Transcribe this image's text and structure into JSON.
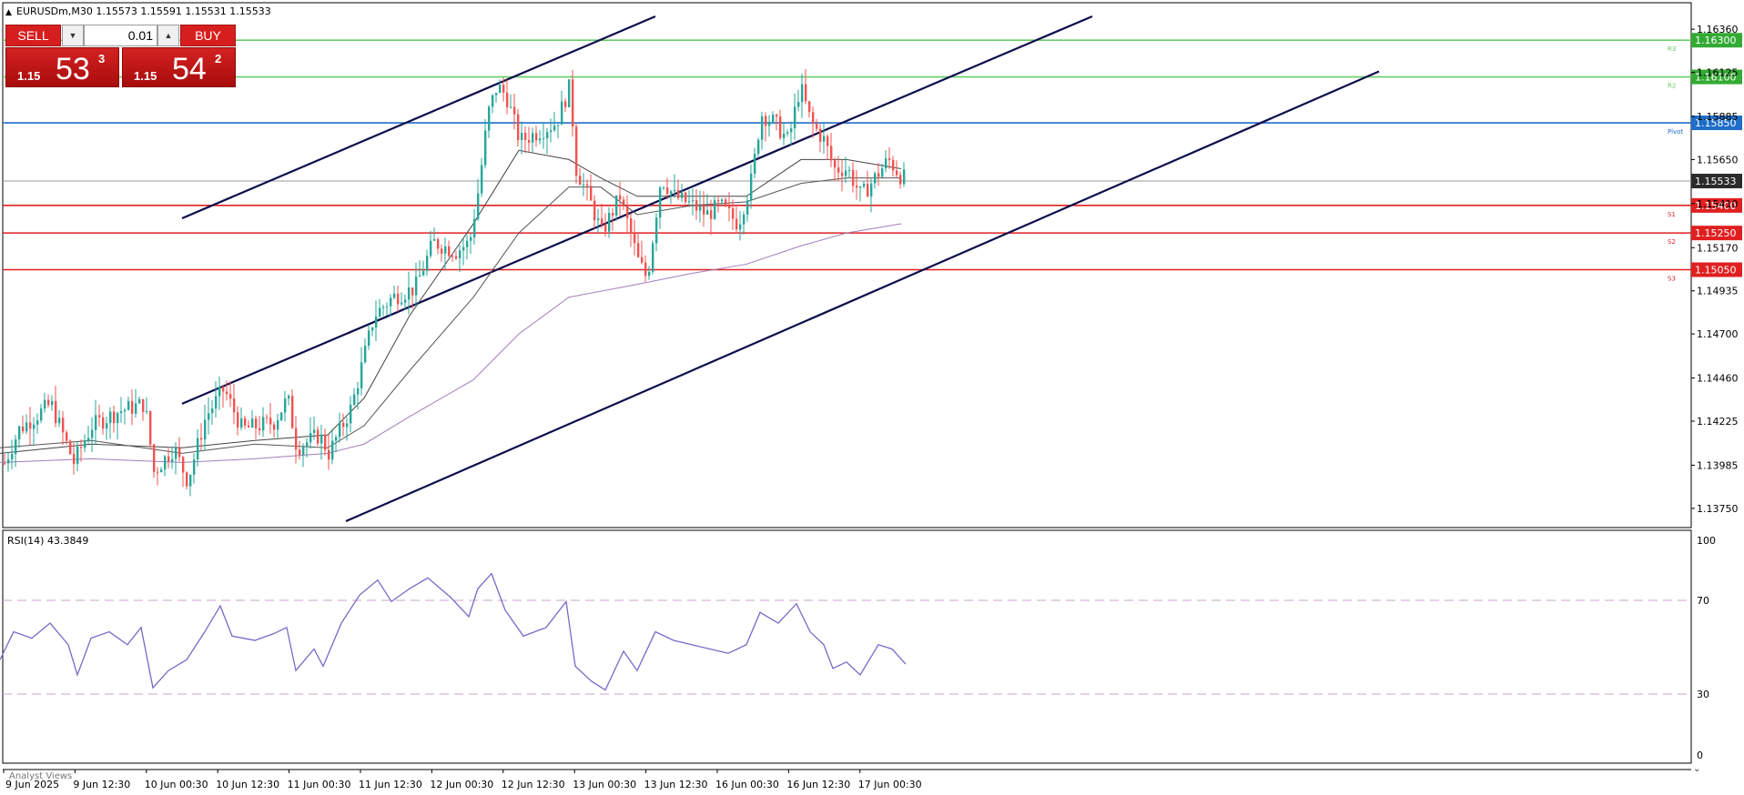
{
  "header": {
    "symbol_line": "EURUSDm,M30  1.15573 1.15591 1.15531 1.15533",
    "collapse_icon": "triangle-up-icon"
  },
  "trade_panel": {
    "sell_label": "SELL",
    "buy_label": "BUY",
    "volume": "0.01",
    "bid": {
      "big": "1.15",
      "pips": "53",
      "point": "3"
    },
    "ask": {
      "big": "1.15",
      "pips": "54",
      "point": "2"
    },
    "buy_color": "#d71e1e"
  },
  "levels": [
    {
      "price": 1.163,
      "label": "1.16300",
      "tag": "R3",
      "color": "#66cc66",
      "badge": "#33aa33"
    },
    {
      "price": 1.161,
      "label": "1.16100",
      "tag": "R2",
      "color": "#66cc66",
      "badge": "#33aa33"
    },
    {
      "price": 1.1585,
      "label": "1.15850",
      "tag": "Pivot",
      "color": "#1e6ec8",
      "badge": "#1e6ec8"
    },
    {
      "price": 1.15533,
      "label": "1.15533",
      "tag": "",
      "color": "#999999",
      "badge": "#2b2b2b"
    },
    {
      "price": 1.154,
      "label": "1.15400",
      "tag": "S1",
      "color": "#e02020",
      "badge": "#e02020"
    },
    {
      "price": 1.1525,
      "label": "1.15250",
      "tag": "S2",
      "color": "#e02020",
      "badge": "#e02020"
    },
    {
      "price": 1.1505,
      "label": "1.15050",
      "tag": "S3",
      "color": "#e02020",
      "badge": "#e02020"
    }
  ],
  "price_axis": [
    "1.16360",
    "1.16125",
    "1.15885",
    "1.15650",
    "1.15410",
    "1.15170",
    "1.14935",
    "1.14700",
    "1.14460",
    "1.14225",
    "1.13985",
    "1.13750"
  ],
  "time_axis": [
    "9 Jun 2025",
    "9 Jun 12:30",
    "10 Jun 00:30",
    "10 Jun 12:30",
    "11 Jun 00:30",
    "11 Jun 12:30",
    "12 Jun 00:30",
    "12 Jun 12:30",
    "13 Jun 00:30",
    "13 Jun 12:30",
    "16 Jun 00:30",
    "16 Jun 12:30",
    "17 Jun 00:30"
  ],
  "rsi": {
    "title": "RSI(14) 43.3849",
    "axis": [
      "100",
      "70",
      "30",
      "0"
    ],
    "line_color": "#7b68c8"
  },
  "bottom_tab": "Analyst Views",
  "chart_data": {
    "type": "candlestick",
    "symbol": "EURUSDm",
    "timeframe": "M30",
    "ohlc_last": {
      "open": 1.15573,
      "high": 1.15591,
      "low": 1.15531,
      "close": 1.15533
    },
    "colors": {
      "up": "#26a69a",
      "down": "#ef5350"
    },
    "ylim": [
      1.1368,
      1.1642
    ],
    "price_path": [
      [
        0,
        1.1395
      ],
      [
        20,
        1.1418
      ],
      [
        55,
        1.1432
      ],
      [
        80,
        1.14
      ],
      [
        100,
        1.142
      ],
      [
        130,
        1.1428
      ],
      [
        158,
        1.1432
      ],
      [
        168,
        1.1395
      ],
      [
        190,
        1.1408
      ],
      [
        205,
        1.139
      ],
      [
        225,
        1.1425
      ],
      [
        245,
        1.144
      ],
      [
        265,
        1.1418
      ],
      [
        300,
        1.1422
      ],
      [
        315,
        1.1435
      ],
      [
        325,
        1.1408
      ],
      [
        350,
        1.1415
      ],
      [
        360,
        1.1405
      ],
      [
        385,
        1.143
      ],
      [
        400,
        1.146
      ],
      [
        410,
        1.148
      ],
      [
        430,
        1.149
      ],
      [
        455,
        1.1495
      ],
      [
        475,
        1.152
      ],
      [
        500,
        1.1515
      ],
      [
        515,
        1.152
      ],
      [
        525,
        1.155
      ],
      [
        535,
        1.159
      ],
      [
        545,
        1.1605
      ],
      [
        555,
        1.16
      ],
      [
        570,
        1.1575
      ],
      [
        590,
        1.158
      ],
      [
        610,
        1.1585
      ],
      [
        625,
        1.1605
      ],
      [
        632,
        1.156
      ],
      [
        645,
        1.1545
      ],
      [
        660,
        1.1525
      ],
      [
        680,
        1.1545
      ],
      [
        700,
        1.151
      ],
      [
        710,
        1.15
      ],
      [
        725,
        1.1555
      ],
      [
        740,
        1.1545
      ],
      [
        760,
        1.154
      ],
      [
        775,
        1.1535
      ],
      [
        790,
        1.154
      ],
      [
        810,
        1.153
      ],
      [
        825,
        1.1555
      ],
      [
        835,
        1.159
      ],
      [
        850,
        1.1585
      ],
      [
        865,
        1.1575
      ],
      [
        878,
        1.1605
      ],
      [
        890,
        1.1585
      ],
      [
        905,
        1.1575
      ],
      [
        915,
        1.156
      ],
      [
        930,
        1.156
      ],
      [
        945,
        1.1545
      ],
      [
        960,
        1.1555
      ],
      [
        975,
        1.1565
      ],
      [
        990,
        1.1555
      ]
    ],
    "moving_averages": [
      {
        "color": "#444444",
        "path": [
          [
            0,
            1.1405
          ],
          [
            100,
            1.141
          ],
          [
            200,
            1.1408
          ],
          [
            280,
            1.1412
          ],
          [
            360,
            1.1415
          ],
          [
            400,
            1.1435
          ],
          [
            450,
            1.148
          ],
          [
            520,
            1.153
          ],
          [
            570,
            1.157
          ],
          [
            625,
            1.1565
          ],
          [
            660,
            1.1555
          ],
          [
            700,
            1.1545
          ],
          [
            760,
            1.1545
          ],
          [
            820,
            1.1545
          ],
          [
            880,
            1.1565
          ],
          [
            930,
            1.1565
          ],
          [
            990,
            1.156
          ]
        ]
      },
      {
        "color": "#555555",
        "path": [
          [
            0,
            1.1408
          ],
          [
            100,
            1.1412
          ],
          [
            200,
            1.1405
          ],
          [
            280,
            1.141
          ],
          [
            360,
            1.1408
          ],
          [
            400,
            1.142
          ],
          [
            450,
            1.145
          ],
          [
            520,
            1.149
          ],
          [
            570,
            1.1525
          ],
          [
            625,
            1.155
          ],
          [
            660,
            1.155
          ],
          [
            700,
            1.1535
          ],
          [
            760,
            1.154
          ],
          [
            820,
            1.1542
          ],
          [
            880,
            1.1552
          ],
          [
            930,
            1.1555
          ],
          [
            990,
            1.1555
          ]
        ]
      },
      {
        "color": "#a07fb8",
        "path": [
          [
            0,
            1.14
          ],
          [
            100,
            1.1402
          ],
          [
            200,
            1.14
          ],
          [
            280,
            1.1402
          ],
          [
            360,
            1.1405
          ],
          [
            400,
            1.141
          ],
          [
            450,
            1.1425
          ],
          [
            520,
            1.1445
          ],
          [
            570,
            1.147
          ],
          [
            625,
            1.149
          ],
          [
            700,
            1.1497
          ],
          [
            760,
            1.1503
          ],
          [
            820,
            1.1508
          ],
          [
            880,
            1.1518
          ],
          [
            930,
            1.1525
          ],
          [
            990,
            1.153
          ]
        ]
      }
    ],
    "trend_lines": [
      {
        "from": [
          200,
          1.1533
        ],
        "to": [
          720,
          1.1643
        ],
        "color": "#0d0d4d"
      },
      {
        "from": [
          200,
          1.1432
        ],
        "to": [
          1200,
          1.1643
        ],
        "color": "#0d0d4d"
      },
      {
        "from": [
          380,
          1.1368
        ],
        "to": [
          1515,
          1.1613
        ],
        "color": "#0d0d4d"
      }
    ],
    "rsi_path": [
      [
        0,
        45
      ],
      [
        15,
        58
      ],
      [
        35,
        55
      ],
      [
        55,
        62
      ],
      [
        75,
        52
      ],
      [
        85,
        38
      ],
      [
        100,
        55
      ],
      [
        120,
        58
      ],
      [
        140,
        52
      ],
      [
        155,
        60
      ],
      [
        168,
        32
      ],
      [
        185,
        40
      ],
      [
        205,
        45
      ],
      [
        225,
        58
      ],
      [
        242,
        70
      ],
      [
        255,
        56
      ],
      [
        280,
        54
      ],
      [
        300,
        57
      ],
      [
        315,
        60
      ],
      [
        325,
        40
      ],
      [
        345,
        50
      ],
      [
        355,
        42
      ],
      [
        375,
        62
      ],
      [
        395,
        75
      ],
      [
        415,
        82
      ],
      [
        430,
        72
      ],
      [
        450,
        78
      ],
      [
        470,
        83
      ],
      [
        495,
        74
      ],
      [
        515,
        65
      ],
      [
        525,
        78
      ],
      [
        540,
        85
      ],
      [
        555,
        68
      ],
      [
        575,
        56
      ],
      [
        600,
        60
      ],
      [
        622,
        72
      ],
      [
        632,
        42
      ],
      [
        650,
        35
      ],
      [
        665,
        31
      ],
      [
        685,
        49
      ],
      [
        700,
        40
      ],
      [
        720,
        58
      ],
      [
        740,
        54
      ],
      [
        760,
        52
      ],
      [
        780,
        50
      ],
      [
        800,
        48
      ],
      [
        820,
        52
      ],
      [
        835,
        67
      ],
      [
        855,
        62
      ],
      [
        875,
        71
      ],
      [
        890,
        58
      ],
      [
        905,
        52
      ],
      [
        915,
        41
      ],
      [
        930,
        44
      ],
      [
        945,
        38
      ],
      [
        965,
        52
      ],
      [
        980,
        50
      ],
      [
        995,
        43
      ]
    ]
  }
}
